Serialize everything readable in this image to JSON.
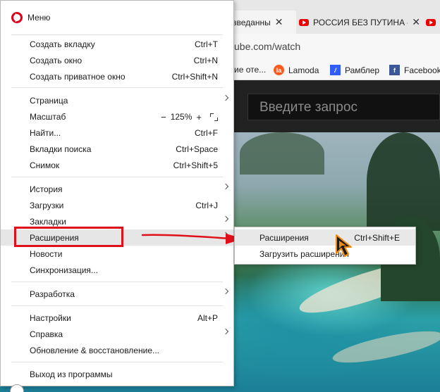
{
  "tabs": [
    {
      "label": "зведанны",
      "close": "✕"
    },
    {
      "label": "РОССИЯ БЕЗ ПУТИНА –",
      "close": "✕"
    },
    {
      "label": ""
    }
  ],
  "address": {
    "url": "ube.com/watch"
  },
  "bookmarks": [
    {
      "label": "ие оте...",
      "icon": ""
    },
    {
      "label": "Lamoda",
      "icon": "la"
    },
    {
      "label": "Рамблер",
      "icon": "/"
    },
    {
      "label": "Facebook",
      "icon": "f"
    }
  ],
  "youtube": {
    "search_placeholder": "Введите запрос"
  },
  "menu": {
    "title": "Меню",
    "items": [
      {
        "label": "Создать вкладку",
        "shortcut": "Ctrl+T"
      },
      {
        "label": "Создать окно",
        "shortcut": "Ctrl+N"
      },
      {
        "label": "Создать приватное окно",
        "shortcut": "Ctrl+Shift+N"
      },
      {
        "label": "Страница",
        "shortcut": ""
      },
      {
        "label": "Масштаб",
        "shortcut": ""
      },
      {
        "label": "Найти...",
        "shortcut": "Ctrl+F"
      },
      {
        "label": "Вкладки поиска",
        "shortcut": "Ctrl+Space"
      },
      {
        "label": "Снимок",
        "shortcut": "Ctrl+Shift+5"
      },
      {
        "label": "История",
        "shortcut": ""
      },
      {
        "label": "Загрузки",
        "shortcut": "Ctrl+J"
      },
      {
        "label": "Закладки",
        "shortcut": ""
      },
      {
        "label": "Расширения",
        "shortcut": ""
      },
      {
        "label": "Новости",
        "shortcut": ""
      },
      {
        "label": "Синхронизация...",
        "shortcut": ""
      },
      {
        "label": "Разработка",
        "shortcut": ""
      },
      {
        "label": "Настройки",
        "shortcut": "Alt+P"
      },
      {
        "label": "Справка",
        "shortcut": ""
      },
      {
        "label": "Обновление & восстановление...",
        "shortcut": ""
      },
      {
        "label": "Выход из программы",
        "shortcut": ""
      }
    ],
    "zoom": {
      "minus": "−",
      "value": "125%",
      "plus": "+"
    }
  },
  "submenu": {
    "items": [
      {
        "label": "Расширения",
        "shortcut": "Ctrl+Shift+E"
      },
      {
        "label": "Загрузить расширения",
        "shortcut": ""
      }
    ]
  },
  "colors": {
    "highlight": "#e0101a",
    "opera_red": "#e0001b",
    "cursor_orange": "#f28a10"
  }
}
